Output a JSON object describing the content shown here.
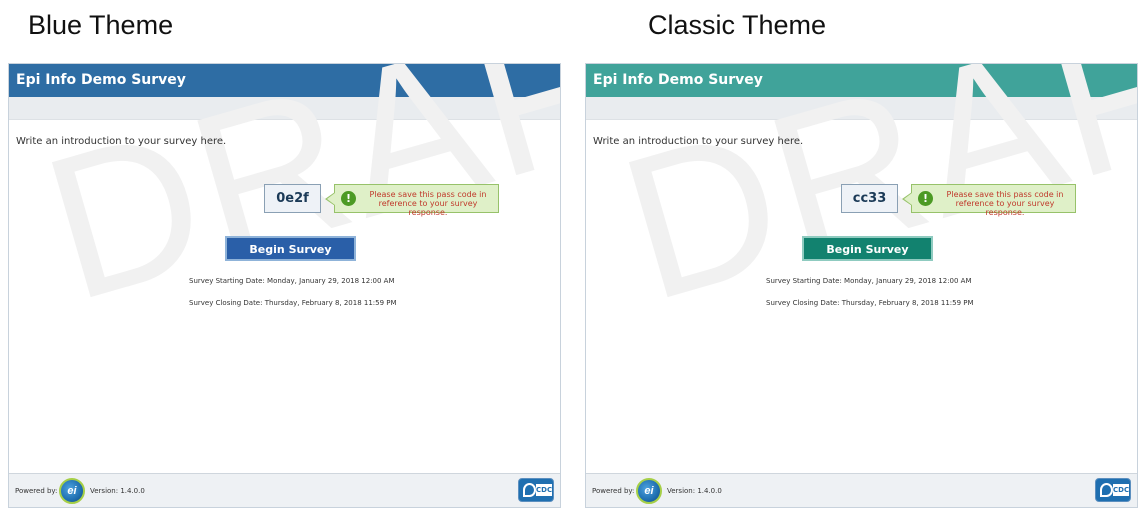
{
  "captions": {
    "blue": "Blue Theme",
    "classic": "Classic Theme"
  },
  "colors": {
    "blue_header": "#2e6da4",
    "blue_button": "#2a5fa8",
    "classic_header": "#40a39a",
    "classic_button": "#12826f"
  },
  "watermark": "DRAFT",
  "blue_panel": {
    "title": "Epi Info Demo Survey",
    "intro": "Write an introduction to your survey here.",
    "pass_code": "0e2f",
    "tip_icon": "!",
    "tip_text": "Please save this pass code in reference to your survey response.",
    "begin_label": "Begin Survey",
    "start_date": "Survey Starting Date: Monday, January 29, 2018 12:00 AM",
    "close_date": "Survey Closing Date: Thursday, February 8, 2018 11:59 PM",
    "powered_by": "Powered by:",
    "ei_logo_text": "ei",
    "version": "Version: 1.4.0.0",
    "cdc_text": "CDC"
  },
  "classic_panel": {
    "title": "Epi Info Demo Survey",
    "intro": "Write an introduction to your survey here.",
    "pass_code": "cc33",
    "tip_icon": "!",
    "tip_text": "Please save this pass code in reference to your survey response.",
    "begin_label": "Begin Survey",
    "start_date": "Survey Starting Date: Monday, January 29, 2018 12:00 AM",
    "close_date": "Survey Closing Date: Thursday, February 8, 2018 11:59 PM",
    "powered_by": "Powered by:",
    "ei_logo_text": "ei",
    "version": "Version: 1.4.0.0",
    "cdc_text": "CDC"
  }
}
